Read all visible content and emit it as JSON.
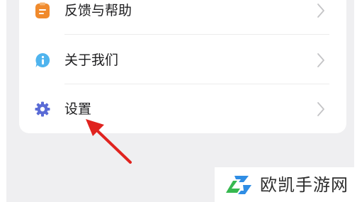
{
  "menu": {
    "items": [
      {
        "label": "反馈与帮助",
        "icon": "clipboard-icon"
      },
      {
        "label": "关于我们",
        "icon": "info-bubble-icon"
      },
      {
        "label": "设置",
        "icon": "gear-icon"
      }
    ]
  },
  "colors": {
    "feedback_icon": "#f08a2c",
    "about_icon": "#4fb4ee",
    "settings_icon": "#5a6bd6",
    "arrow": "#e0231f",
    "chevron": "#c4c4c6"
  },
  "watermark": {
    "text": "欧凯手游网",
    "icon": "watermark-logo-icon"
  }
}
